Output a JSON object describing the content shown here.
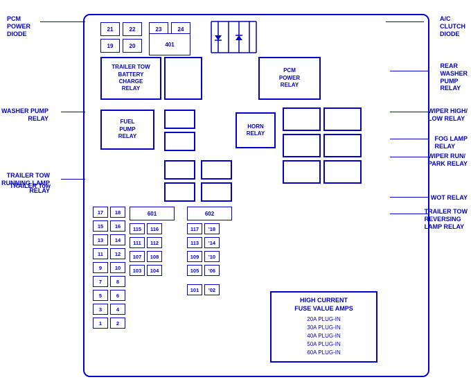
{
  "labels": {
    "pcm_power_diode": "PCM\nPOWER\nDIODE",
    "ac_clutch_diode": "A/C\nCLUTCH\nDIODE",
    "rear_washer_pump_relay": "REAR\nWASHER\nPUMP\nRELAY",
    "washer_pump_relay": "WASHER PUMP\nRELAY",
    "wiper_high_low_relay": "WIPER HIGH/\nLOW RELAY",
    "fog_lamp_relay": "FOG LAMP\nRELAY",
    "wiper_run_park_relay": "WIPER RUN/\nPARK RELAY",
    "trailer_tow_running_lamp": "TRAILER TOW\nRUNNING LAMP\nRELAY",
    "wot_relay": "WOT RELAY",
    "trailer_tow_reversing": "TRAILER TOW\nREVERSING\nLAMP RELAY",
    "trailer_tow_label": "TRAILER Tow"
  },
  "relay_boxes": {
    "trailer_tow_battery": "TRAILER TOW\nBATTERY\nCHARGE\nRELAY",
    "fuel_pump_relay": "FUEL\nPUMP\nRELAY",
    "pcm_power_relay": "PCM\nPOWER\nRELAY",
    "horn_relay": "HORN\nRELAY"
  },
  "fuses_top": {
    "f21": "21",
    "f22": "22",
    "f23": "23",
    "f24": "24",
    "f19": "19",
    "f20": "20",
    "f401": "401"
  },
  "fuses_left_column": {
    "f17": "17",
    "f18": "18",
    "f15": "15",
    "f16": "16",
    "f13": "13",
    "f14": "14",
    "f11": "11",
    "f12": "12",
    "f9": "9",
    "f10": "10",
    "f7": "7",
    "f8": "8",
    "f5": "5",
    "f6": "6",
    "f3": "3",
    "f4": "4",
    "f1": "1",
    "f2": "2"
  },
  "fuses_center": {
    "f601": "601",
    "f602": "602",
    "f115": "115",
    "f116": "116",
    "f117": "117",
    "f118": "118",
    "f111": "111",
    "f112": "112",
    "f113": "113",
    "f114": "114",
    "f107": "107",
    "f108": "108",
    "f109": "109",
    "f110": "110",
    "f103": "103",
    "f104": "104",
    "f105": "105",
    "f106": "106",
    "f101": "101",
    "f102": "102"
  },
  "high_current_box": {
    "title": "HIGH CURRENT\nFUSE VALUE AMPS",
    "lines": [
      "20A PLUG-IN",
      "30A PLUG-IN",
      "40A PLUG-IN",
      "50A PLUG-IN",
      "60A PLUG-IN"
    ]
  }
}
